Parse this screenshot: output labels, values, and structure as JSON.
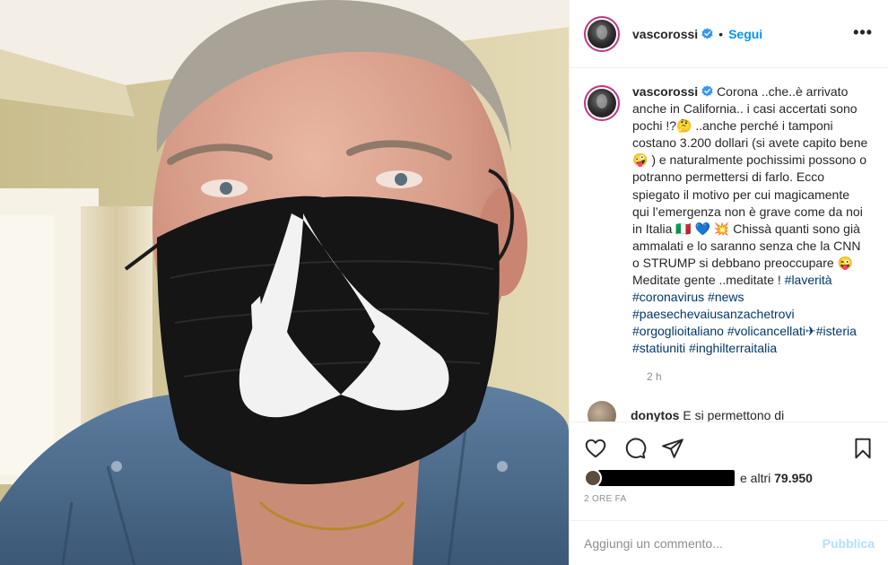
{
  "post": {
    "username": "vascorossi",
    "follow_label": "Segui",
    "more_label": "•••",
    "dot": "•",
    "caption": {
      "username": "vascorossi",
      "text": "Corona ..che..è arrivato anche in California.. i casi accertati sono pochi !?🤔  ..anche perché i tamponi costano 3.200 dollari (si avete capito bene🤪 ) e naturalmente pochissimi possono o potranno permettersi di farlo. Ecco spiegato il motivo per cui magicamente qui l’emergenza non è grave come da noi in Italia 🇮🇹 💙 💥 Chissà quanti sono già ammalati e lo saranno senza che la CNN o STRUMP si debbano preoccupare 😜  Meditate gente ..meditate ! ",
      "hashtags": [
        "#laverità",
        "#coronavirus",
        "#news",
        "#paesechevaiusanzachetrovi",
        "#orgoglioitaliano",
        "#volicancellati✈",
        "#isteria",
        "#statiuniti",
        "#inghilterraitalia"
      ]
    },
    "caption_time": "2 h",
    "next_comment": {
      "username": "donytos",
      "text": "E si permettono di"
    }
  },
  "actions": {
    "like_icon": "heart-icon",
    "comment_icon": "comment-icon",
    "share_icon": "paper-plane-icon",
    "save_icon": "bookmark-icon"
  },
  "likes": {
    "suffix": "e altri",
    "count": "79.950"
  },
  "timestamp": "2 ORE FA",
  "add_comment": {
    "placeholder": "Aggiungi un commento...",
    "publish_label": "Pubblica"
  },
  "colors": {
    "accent": "#0095f6",
    "publish_disabled": "#b2dffc",
    "hashtag": "#00376b",
    "verified": "#3897f0"
  }
}
